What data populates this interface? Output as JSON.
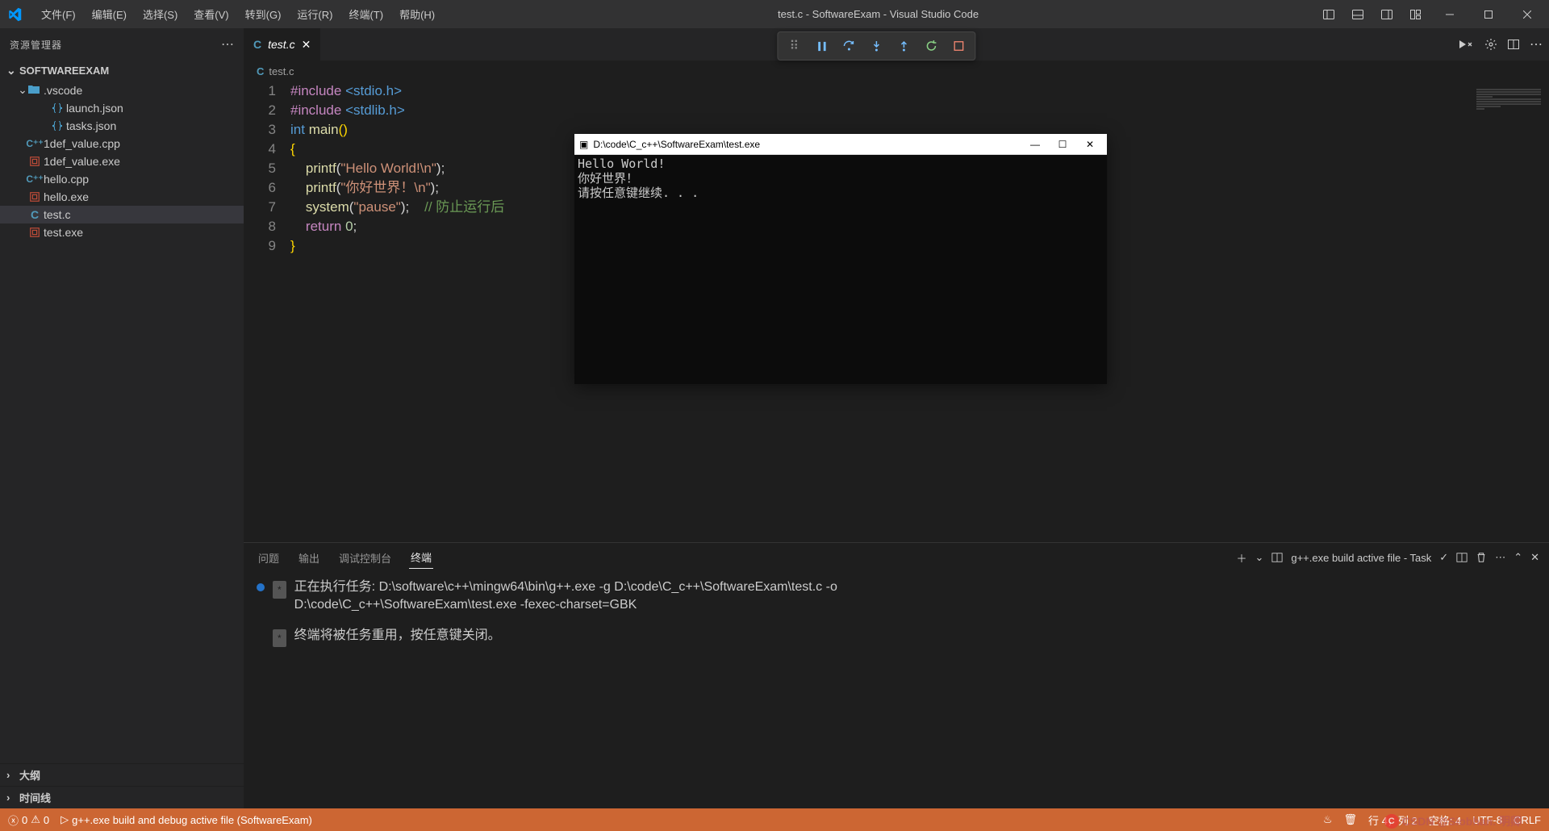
{
  "titlebar": {
    "menus": [
      "文件(F)",
      "编辑(E)",
      "选择(S)",
      "查看(V)",
      "转到(G)",
      "运行(R)",
      "终端(T)",
      "帮助(H)"
    ],
    "title": "test.c - SoftwareExam - Visual Studio Code"
  },
  "sidebar": {
    "title": "资源管理器",
    "folder": "SOFTWAREEXAM",
    "tree": [
      {
        "name": ".vscode",
        "type": "folder",
        "depth": 1
      },
      {
        "name": "launch.json",
        "type": "json",
        "depth": 2
      },
      {
        "name": "tasks.json",
        "type": "json",
        "depth": 2
      },
      {
        "name": "1def_value.cpp",
        "type": "cpp",
        "depth": 1
      },
      {
        "name": "1def_value.exe",
        "type": "exe",
        "depth": 1
      },
      {
        "name": "hello.cpp",
        "type": "cpp",
        "depth": 1
      },
      {
        "name": "hello.exe",
        "type": "exe",
        "depth": 1
      },
      {
        "name": "test.c",
        "type": "c",
        "depth": 1,
        "active": true
      },
      {
        "name": "test.exe",
        "type": "exe",
        "depth": 1
      }
    ],
    "sections": [
      "大纲",
      "时间线"
    ]
  },
  "editor": {
    "tab": {
      "name": "test.c",
      "icon": "C"
    },
    "breadcrumb": "test.c",
    "code": [
      {
        "n": 1,
        "html": "<span class='kw'>#include</span> <span class='ty'>&lt;stdio.h&gt;</span>"
      },
      {
        "n": 2,
        "html": "<span class='kw'>#include</span> <span class='ty'>&lt;stdlib.h&gt;</span>"
      },
      {
        "n": 3,
        "html": "<span class='ty'>int</span> <span class='fn'>main</span><span class='br'>()</span>"
      },
      {
        "n": 4,
        "html": "<span class='br'>{</span>"
      },
      {
        "n": 5,
        "html": "    <span class='fn'>printf</span>(<span class='st'>\"Hello World!\\n\"</span>);"
      },
      {
        "n": 6,
        "html": "    <span class='fn'>printf</span>(<span class='st'>\"你好世界！\\n\"</span>);"
      },
      {
        "n": 7,
        "html": "    <span class='fn'>system</span>(<span class='st'>\"pause\"</span>);    <span class='cm'>// 防止运行后</span>"
      },
      {
        "n": 8,
        "html": "    <span class='kw'>return</span> <span class='nm'>0</span>;"
      },
      {
        "n": 9,
        "html": "<span class='br'>}</span>"
      }
    ]
  },
  "panel": {
    "tabs": [
      "问题",
      "输出",
      "调试控制台",
      "终端"
    ],
    "active": 3,
    "task_label": "g++.exe build active file - Task",
    "lines": [
      "正在执行任务: D:\\software\\c++\\mingw64\\bin\\g++.exe -g D:\\code\\C_c++\\SoftwareExam\\test.c -o D:\\code\\C_c++\\SoftwareExam\\test.exe -fexec-charset=GBK",
      "终端将被任务重用，按任意键关闭。"
    ]
  },
  "console": {
    "title": "D:\\code\\C_c++\\SoftwareExam\\test.exe",
    "output": "Hello World!\n你好世界！\n请按任意键继续. . ."
  },
  "statusbar": {
    "errors": "0",
    "warnings": "0",
    "debug_config": "g++.exe build and debug active file (SoftwareExam)",
    "cursor": "行 4，列 2",
    "spaces": "空格: 4",
    "encoding": "UTF-8",
    "eol": "CRLF"
  },
  "watermark": "CSDN @Siobhan. 明卿"
}
